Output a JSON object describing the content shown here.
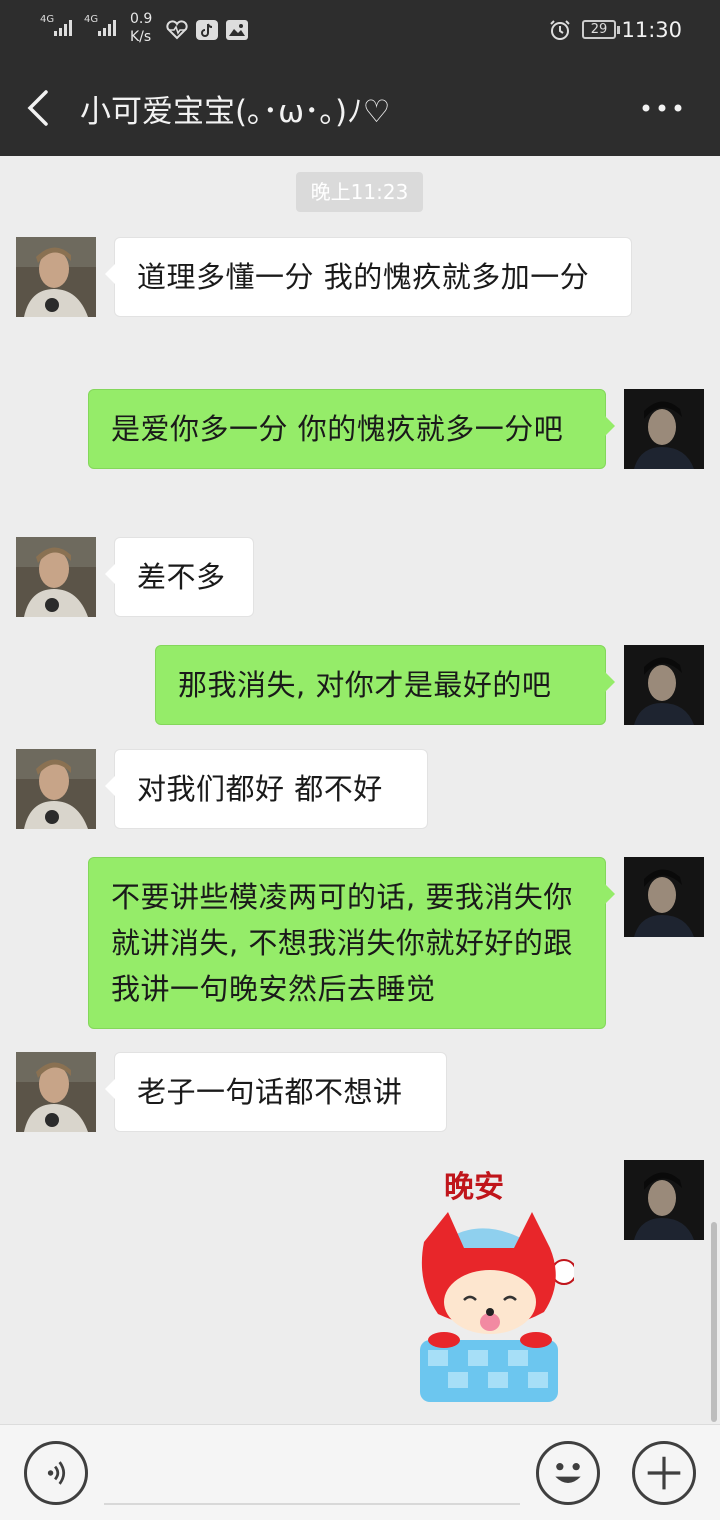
{
  "status_bar": {
    "signal_1": "4G",
    "signal_2": "4G",
    "net_speed_value": "0.9",
    "net_speed_unit": "K/s",
    "icons": [
      "heart-rate-icon",
      "tiktok-icon",
      "gallery-icon",
      "alarm-icon"
    ],
    "battery": "29",
    "time": "11:30"
  },
  "header": {
    "title": "小可爱宝宝(｡･ω･｡)ﾉ♡",
    "back_icon": "chevron-left-icon",
    "more_icon": "more-dots-icon"
  },
  "chat": {
    "timestamp": "晚上11:23",
    "messages": [
      {
        "side": "in",
        "text": "道理多懂一分 我的愧疚就多加一分"
      },
      {
        "side": "out",
        "text": "是爱你多一分  你的愧疚就多一分吧"
      },
      {
        "side": "in",
        "text": "差不多"
      },
      {
        "side": "out",
        "text": "那我消失, 对你才是最好的吧"
      },
      {
        "side": "in",
        "text": "对我们都好 都不好"
      },
      {
        "side": "out",
        "text": "不要讲些模凌两可的话, 要我消失你就讲消失, 不想我消失你就好好的跟我讲一句晚安然后去睡觉"
      },
      {
        "side": "in",
        "text": "老子一句话都不想讲"
      }
    ],
    "sticker": {
      "text": "晚安",
      "icon": "goodnight-fox-sticker"
    }
  },
  "input_bar": {
    "voice_icon": "voice-icon",
    "emoji_icon": "emoji-icon",
    "plus_icon": "plus-icon",
    "value": ""
  },
  "colors": {
    "header_bg": "#2d2d2d",
    "chat_bg": "#ededed",
    "outgoing_bubble": "#95ec69",
    "incoming_bubble": "#ffffff"
  }
}
